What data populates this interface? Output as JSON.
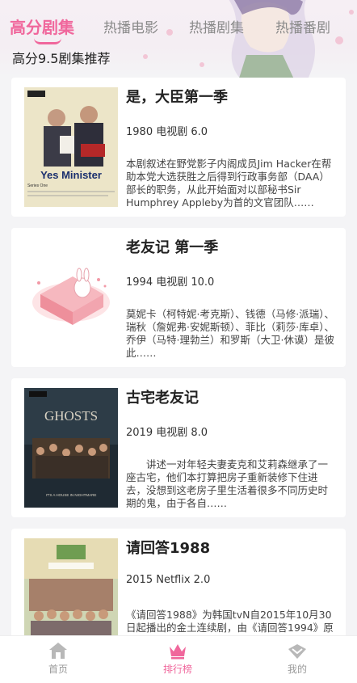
{
  "tabs": [
    {
      "label": "高分剧集",
      "active": true
    },
    {
      "label": "热播电影",
      "active": false
    },
    {
      "label": "热播剧集",
      "active": false
    },
    {
      "label": "热播番剧",
      "active": false
    }
  ],
  "subtitle": "高分9.5剧集推荐",
  "items": [
    {
      "title": "是，大臣第一季",
      "meta": "1980 电视剧 6.0",
      "desc": "本剧叙述在野党影子内阁成员Jim Hacker在帮助本党大选获胜之后得到行政事务部（DAA）部长的职务，从此开始面对以部秘书Sir Humphrey Appleby为首的文官团队……",
      "poster_text": "Yes Minister",
      "poster_sub": "Series One"
    },
    {
      "title": "老友记 第一季",
      "meta": "1994 电视剧 10.0",
      "desc": "莫妮卡（柯特妮·考克斯）、钱德（马修·派瑞）、瑞秋（詹妮弗·安妮斯顿）、菲比（莉莎·库卓）、乔伊（马特·理勃兰）和罗斯（大卫·休谟）是彼此……"
    },
    {
      "title": "古宅老友记",
      "meta": "2019 电视剧 8.0",
      "desc": "　　讲述一对年轻夫妻麦克和艾莉森继承了一座古宅，他们本打算把房子重新装修下住进去，没想到这老房子里生活着很多不同历史时期的鬼，由于各自……",
      "poster_text": "GHOSTS",
      "poster_sub": "IT'S A HOUSE IN NIGHTMARE"
    },
    {
      "title": "请回答1988",
      "meta": "2015 Netflix 2.0",
      "desc": "《请回答1988》为韩国tvN自2015年10月30日起播出的金土连续剧，由《请回答1994》原班人马打造……"
    }
  ],
  "nav": [
    {
      "label": "首页",
      "icon": "home-icon",
      "active": false
    },
    {
      "label": "排行榜",
      "icon": "crown-icon",
      "active": true
    },
    {
      "label": "我的",
      "icon": "heart-icon",
      "active": false
    }
  ],
  "colors": {
    "accent": "#f0679c",
    "inactive": "#999999",
    "background": "#f4f4f6"
  }
}
